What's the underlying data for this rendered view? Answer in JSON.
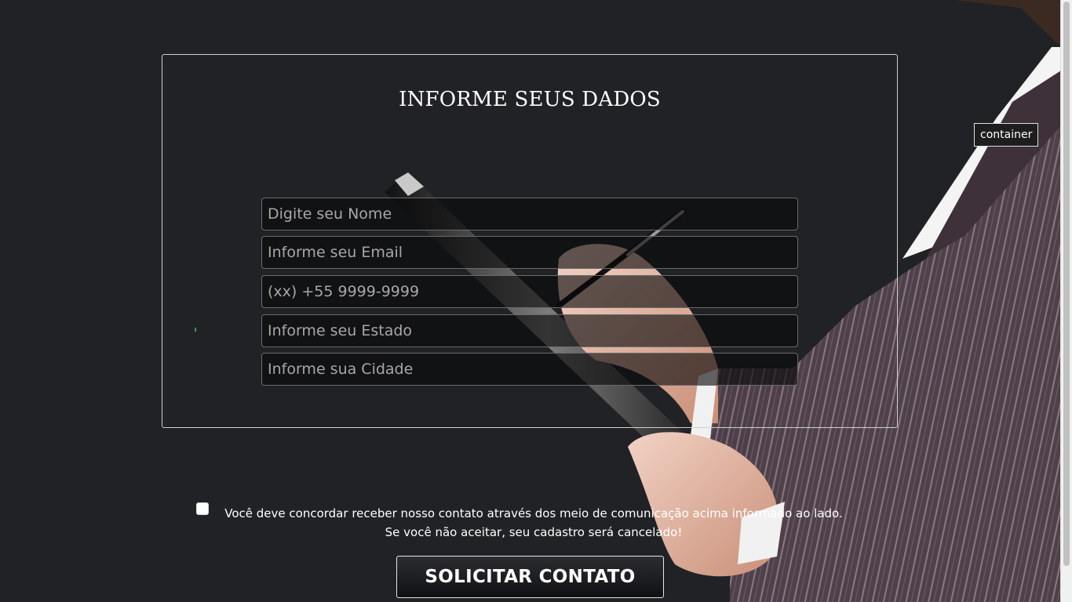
{
  "form": {
    "title": "INFORME SEUS DADOS",
    "fields": [
      {
        "name": "name",
        "placeholder": "Digite seu Nome",
        "value": ""
      },
      {
        "name": "email",
        "placeholder": "Informe seu Email",
        "value": ""
      },
      {
        "name": "phone",
        "placeholder": "(xx) +55 9999-9999",
        "value": ""
      },
      {
        "name": "state",
        "placeholder": "Informe seu Estado",
        "value": ""
      },
      {
        "name": "city",
        "placeholder": "Informe sua Cidade",
        "value": ""
      }
    ]
  },
  "tooltip": {
    "label": "container"
  },
  "consent": {
    "checked": false,
    "text": "Você deve concordar receber nosso contato através dos meio de comunicação acima informado ao lado. Se você não aceitar, seu cadastro será cancelado!"
  },
  "submit": {
    "label": "SOLICITAR CONTATO"
  },
  "colors": {
    "background": "#202225",
    "suit": "#5a4a52",
    "text": "#ffffff",
    "field_border": "#6b6b6b"
  },
  "background_image": "businesswoman-with-clipboard-and-pen"
}
